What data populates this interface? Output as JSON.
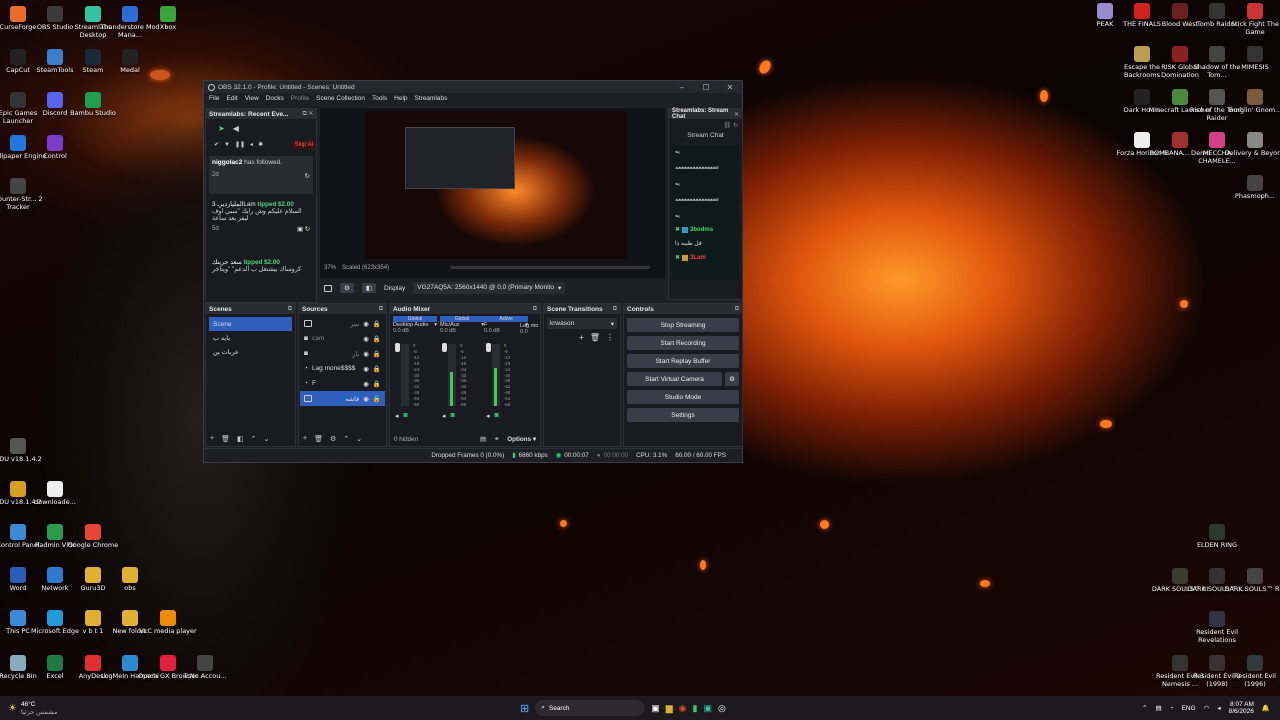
{
  "desktop": {
    "left_icons": [
      {
        "label": "CurseForge",
        "color": "#e86d2b"
      },
      {
        "label": "OBS Studio",
        "color": "#3b3b3b"
      },
      {
        "label": "Streamlabs Desktop",
        "color": "#31c3a2"
      },
      {
        "label": "Thunderstore Mod Mana...",
        "color": "#2a6dd6"
      },
      {
        "label": "Xbox",
        "color": "#3aa33a"
      },
      {
        "label": "CapCut",
        "color": "#222"
      },
      {
        "label": "SteamTools",
        "color": "#3d7ec9"
      },
      {
        "label": "Steam",
        "color": "#1b2838"
      },
      {
        "label": "Medal",
        "color": "#222"
      },
      {
        "label": "Epic Games Launcher",
        "color": "#333"
      },
      {
        "label": "Discord",
        "color": "#5865f2"
      },
      {
        "label": "Bambu Studio",
        "color": "#1ea04f"
      },
      {
        "label": "Wallpaper Engine",
        "color": "#2277dd"
      },
      {
        "label": "Control",
        "color": "#7a3cc9"
      },
      {
        "label": "Counter-Str... 2 Tracker",
        "color": "#444"
      },
      {
        "label": "DDU v18.1.4.2",
        "color": "#555"
      },
      {
        "label": "DDU v18.1.4.2",
        "color": "#d4a021"
      },
      {
        "label": "downloade...",
        "color": "#eee"
      },
      {
        "label": "Control Panel",
        "color": "#3a8ad6"
      },
      {
        "label": "Radmin VPN",
        "color": "#2c9a4b"
      },
      {
        "label": "Google Chrome",
        "color": "#e84335"
      },
      {
        "label": "Word",
        "color": "#2b5cb8"
      },
      {
        "label": "Network",
        "color": "#2e7ad0"
      },
      {
        "label": "Guru3D",
        "color": "#e0b030"
      },
      {
        "label": "obs",
        "color": "#e0b030"
      },
      {
        "label": "This PC",
        "color": "#3a8ad6"
      },
      {
        "label": "Microsoft Edge",
        "color": "#1e9bd8"
      },
      {
        "label": "v b t 1",
        "color": "#e0b030"
      },
      {
        "label": "New folder",
        "color": "#e0b030"
      },
      {
        "label": "VLC media player",
        "color": "#f08a00"
      },
      {
        "label": "Recycle Bin",
        "color": "#8ab"
      },
      {
        "label": "Excel",
        "color": "#1f7a44"
      },
      {
        "label": "AnyDesk",
        "color": "#e0302e"
      },
      {
        "label": "LogMeIn Hamachi",
        "color": "#2e8ad0"
      },
      {
        "label": "Opera GX Browser",
        "color": "#e0203c"
      },
      {
        "label": "TcNo Accou...",
        "color": "#444"
      }
    ],
    "right_icons": [
      {
        "label": "PEAK",
        "color": "#9a8ad0"
      },
      {
        "label": "THE FINALS",
        "color": "#d02020"
      },
      {
        "label": "Blood West",
        "color": "#6a2020"
      },
      {
        "label": "Tomb Raider",
        "color": "#333"
      },
      {
        "label": "Stick Fight The Game",
        "color": "#cc3333"
      },
      {
        "label": "Escape the Backrooms",
        "color": "#b8a050"
      },
      {
        "label": "RISK Global Domination",
        "color": "#8a2020"
      },
      {
        "label": "Shadow of the Tom...",
        "color": "#444"
      },
      {
        "label": "MIMESIS",
        "color": "#333"
      },
      {
        "label": "Dark Hours",
        "color": "#222"
      },
      {
        "label": "Minecraft Launcher",
        "color": "#4a8a3a"
      },
      {
        "label": "Rise of the Tomb Raider",
        "color": "#555"
      },
      {
        "label": "Burglin' Gnom...",
        "color": "#7a5a3a"
      },
      {
        "label": "Forza Horizon 6",
        "color": "#eee"
      },
      {
        "label": "BOMBANA... Demo",
        "color": "#a03030"
      },
      {
        "label": "MECCHA CHAMELE...",
        "color": "#d04080"
      },
      {
        "label": "Delivery & Beyond",
        "color": "#888"
      },
      {
        "label": "Phasmoph...",
        "color": "#444"
      },
      {
        "label": "ELDEN RING",
        "color": "#2a3a2a"
      },
      {
        "label": "DARK SOULS™ III",
        "color": "#3a3a30"
      },
      {
        "label": "DARK SOULS™ I...",
        "color": "#333"
      },
      {
        "label": "DARK SOULS™ R...",
        "color": "#444"
      },
      {
        "label": "Resident Evil Revelations",
        "color": "#334"
      },
      {
        "label": "Resident Evil 3 Nemesis ...",
        "color": "#333"
      },
      {
        "label": "Resident Evil 2 (1998)",
        "color": "#3a3030"
      },
      {
        "label": "Resident Evil (1996)",
        "color": "#303a3a"
      }
    ]
  },
  "obs": {
    "title": "OBS 32.1.0 - Profile: Untitled - Scenes: Untitled",
    "menu": [
      "File",
      "Edit",
      "View",
      "Docks",
      "Profile",
      "Scene Collection",
      "Tools",
      "Help",
      "Streamlabs"
    ],
    "recent_events": {
      "title": "Streamlabs: Recent Eve...",
      "skip_label": "Skip Al",
      "events": [
        {
          "user": "niggolac2",
          "text": "has followed.",
          "time": "2d"
        },
        {
          "user": "المليارديرـ 3Lam",
          "text": "tipped $2.00",
          "msg": "السلام عليكم وش رايك \"سبي اوف ليفز بعد ساعة",
          "time": "5d"
        },
        {
          "user": "سعد حرينك",
          "text": "tipped $2.00",
          "msg": "كروساك بيشتغل ب الدعم\" \"ويتاخر",
          "time": ""
        }
      ]
    },
    "preview": {
      "zoom": "37%",
      "scaled": "Scaled (623x354)",
      "display_label": "Display",
      "display_value": "VG27AQ5A: 2560x1440 @ 0,0 (Primary Monito"
    },
    "stream_chat": {
      "title": "Streamlabs: Stream Chat",
      "header": "Stream Chat",
      "lines": [
        "يه",
        "ععععععععععععععه",
        "يه",
        "ععععععععععععععه",
        "يه",
        "3bodms",
        "قل طيبه ذا",
        "3Lam"
      ]
    },
    "scenes": {
      "title": "Scenes",
      "items": [
        "Scene",
        "بايه ب",
        "عربات ين"
      ]
    },
    "sources": {
      "title": "Sources",
      "items": [
        "سر",
        "cam",
        "بار",
        "Lag mone$$$$",
        "F",
        "فاشه"
      ]
    },
    "mixer": {
      "title": "Audio Mixer",
      "channels": [
        {
          "badge": "Global",
          "name": "Desktop Audio",
          "db": "0.0 dB",
          "level": 0.0
        },
        {
          "badge": "Global",
          "name": "Mic/Aux",
          "db": "0.0 dB",
          "level": 0.55
        },
        {
          "badge": "Active",
          "name": "F",
          "db": "0.0 dB",
          "level": 0.62
        }
      ],
      "lag_label": "Lag mo",
      "lag_db": "0.0",
      "hidden": "0 hidden",
      "options": "Options",
      "scale": [
        "0",
        "-6",
        "-12",
        "-18",
        "-24",
        "-30",
        "-36",
        "-42",
        "-48",
        "-54",
        "-60"
      ]
    },
    "transitions": {
      "title": "Scene Transitions",
      "value": "krwason"
    },
    "controls": {
      "title": "Controls",
      "buttons": [
        "Stop Streaming",
        "Start Recording",
        "Start Replay Buffer",
        "Start Virtual Camera",
        "Studio Mode",
        "Settings"
      ]
    },
    "status": {
      "dropped": "Dropped Frames 0 (0.0%)",
      "kbps": "6860 kbps",
      "stream_time": "00:00:07",
      "rec_time": "00:00:00",
      "cpu": "CPU: 3.1%",
      "fps": "60.00 / 60.00 FPS"
    }
  },
  "taskbar": {
    "weather_temp": "46°C",
    "weather_text": "مشمس جزئيا",
    "search": "Search",
    "lang": "ENG",
    "time": "8:07 AM",
    "date": "8/6/2026"
  },
  "colors": {
    "accent": "#2f5fbd",
    "stream_green": "#2ecc71",
    "tip_green": "#4cd37a",
    "chat_green": "#3fdc5a",
    "chat_red": "#ff3b3b"
  }
}
